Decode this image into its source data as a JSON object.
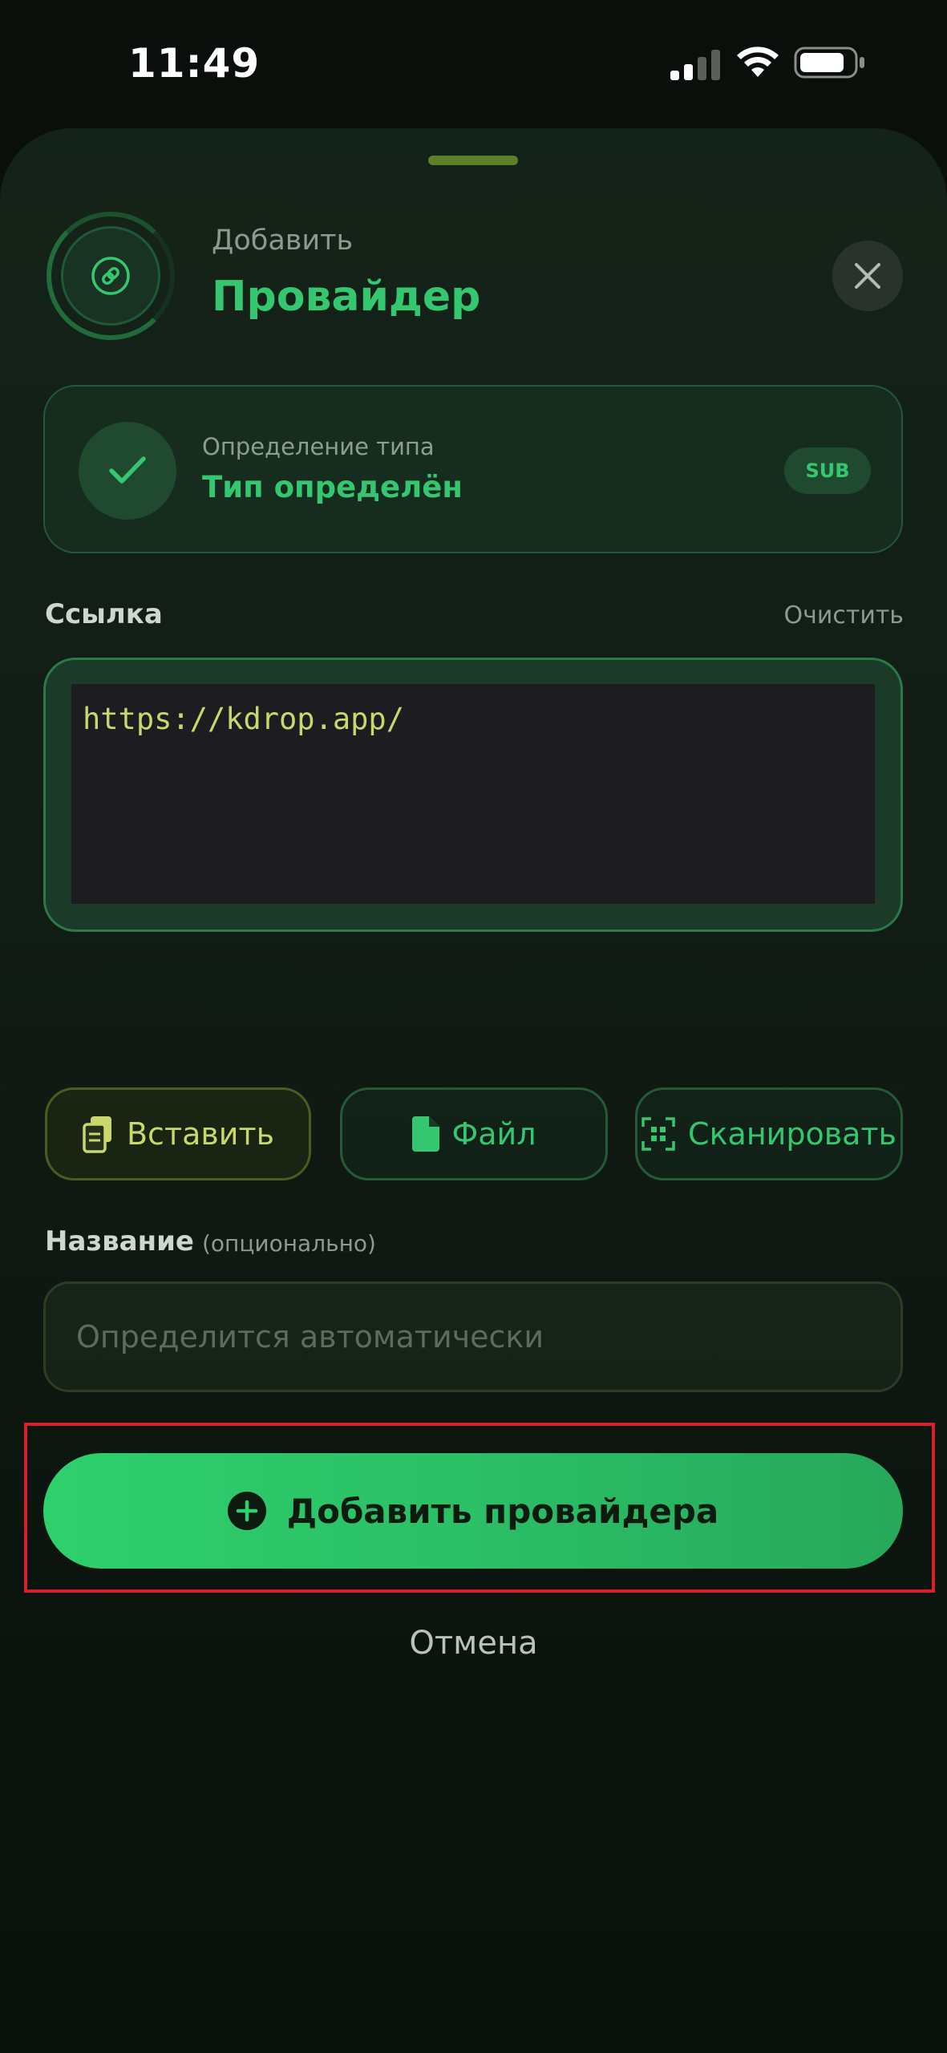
{
  "status_bar": {
    "time": "11:49"
  },
  "header": {
    "subtitle": "Добавить",
    "title": "Провайдер"
  },
  "type_card": {
    "label": "Определение типа",
    "value": "Тип определён",
    "badge": "SUB"
  },
  "link": {
    "label": "Ссылка",
    "clear_label": "Очистить",
    "value": "https://kdrop.app/"
  },
  "actions": {
    "paste_label": "Вставить",
    "file_label": "Файл",
    "scan_label": "Сканировать"
  },
  "name": {
    "label": "Название",
    "optional_label": "(опционально)",
    "placeholder": "Определится автоматически"
  },
  "primary": {
    "label": "Добавить провайдера"
  },
  "cancel": {
    "label": "Отмена"
  },
  "colors": {
    "accent": "#35c770",
    "button_gradient_start": "#2ed06c",
    "button_gradient_end": "#27a85b",
    "link_text": "#c9d86a",
    "highlight": "#d8202a"
  },
  "icons": {
    "header": "link-icon",
    "close": "close-icon",
    "type_status": "checkmark-icon",
    "paste": "clipboard-icon",
    "file": "file-icon",
    "scan": "qr-scan-icon",
    "add": "plus-circle-icon"
  }
}
